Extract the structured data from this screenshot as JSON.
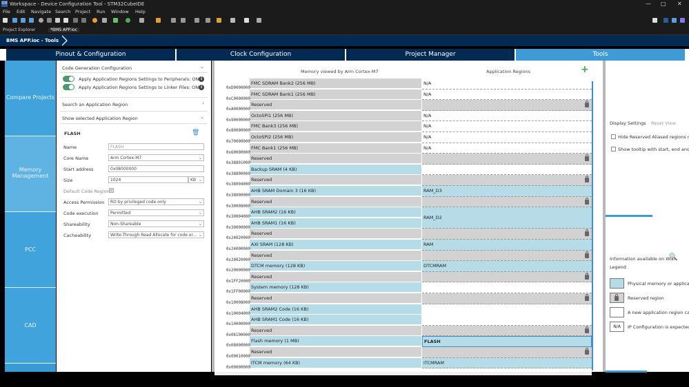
{
  "window": {
    "title": "Workspace - Device Configuration Tool - STM32CubeIDE",
    "controls": [
      "—",
      "□",
      "✕"
    ]
  },
  "menu": [
    "File",
    "Edit",
    "Navigate",
    "Search",
    "Project",
    "Run",
    "Window",
    "Help"
  ],
  "editor_tabs": [
    {
      "label": "Project Explorer",
      "active": false
    },
    {
      "label": "*BMS APP.ioc",
      "active": true
    }
  ],
  "breadcrumb": "BMS APP.ioc - Tools",
  "main_tabs": [
    {
      "label": "Pinout & Configuration",
      "active": false
    },
    {
      "label": "Clock Configuration",
      "active": false
    },
    {
      "label": "Project Manager",
      "active": false
    },
    {
      "label": "Tools",
      "active": true
    }
  ],
  "categories": [
    {
      "label": "Compare Projects",
      "selected": false
    },
    {
      "label": "Memory Management",
      "selected": true
    },
    {
      "label": "PCC",
      "selected": false
    },
    {
      "label": "CAD",
      "selected": false
    }
  ],
  "left": {
    "codegen_title": "Code Generation Configuration",
    "toggle1": "Apply Application Regions Settings to Peripherals: ON",
    "toggle2": "Apply Application Regions Settings to Linker Files: ON",
    "search_region": "Search an Application Region",
    "show_region": "Show selected Application Region",
    "region_title": "FLASH",
    "fields": {
      "name_label": "Name",
      "name_value": "FLASH",
      "core_label": "Core Name",
      "core_value": "Arm Cortex-M7",
      "start_label": "Start address",
      "start_value": "0x08000000",
      "size_label": "Size",
      "size_value": "1024",
      "size_unit": "KB",
      "default_label": "Default Code Region",
      "default_checked": true,
      "access_label": "Access Permission",
      "access_value": "RO by privileged code only",
      "exec_label": "Code execution",
      "exec_value": "Permitted",
      "share_label": "Shareability",
      "share_value": "Non-Shareable",
      "cache_label": "Cacheability",
      "cache_value": "Write-Through Read Allocate for code or..."
    }
  },
  "center": {
    "header_left": "Memory viewed by Arm Cortex-M7",
    "header_right": "Application Regions",
    "addresses": [
      "0xD0000000",
      "0xC0000000",
      "0xA0000000",
      "0x90000000",
      "0x80000000",
      "0x70000000",
      "0x60000000",
      "0x38801000",
      "0x38800000",
      "0x38004000",
      "0x38000000",
      "0x30008000",
      "0x30004000",
      "0x30000000",
      "0x24020000",
      "0x24000000",
      "0x20020000",
      "0x20000000",
      "0x1FF20000",
      "0x1FF00000",
      "0x10008000",
      "0x10004000",
      "0x10000000",
      "0x08100000",
      "0x08000000",
      "0x00010000",
      "0x00000000"
    ],
    "memories": [
      {
        "label": "FMC SDRAM Bank2 (256 MB)",
        "kind": "gray"
      },
      {
        "label": "FMC SDRAM Bank1 (256 MB)",
        "kind": "gray"
      },
      {
        "label": "Reserved",
        "kind": "gray"
      },
      {
        "label": "OctoSPI1 (256 MB)",
        "kind": "gray"
      },
      {
        "label": "FMC Bank3 (256 MB)",
        "kind": "gray"
      },
      {
        "label": "OctoSPI2 (256 MB)",
        "kind": "gray"
      },
      {
        "label": "FMC Bank1 (256 MB)",
        "kind": "gray"
      },
      {
        "label": "Reserved",
        "kind": "gray"
      },
      {
        "label": "Backup SRAM (4 KB)",
        "kind": "blue"
      },
      {
        "label": "Reserved",
        "kind": "gray"
      },
      {
        "label": "AHB SRAM Domain 3 (16 KB)",
        "kind": "blue"
      },
      {
        "label": "Reserved",
        "kind": "gray"
      },
      {
        "label": "AHB SRAM2 (16 KB)",
        "kind": "blue"
      },
      {
        "label": "AHB SRAM1 (16 KB)",
        "kind": "blue"
      },
      {
        "label": "Reserved",
        "kind": "gray"
      },
      {
        "label": "AXI SRAM (128 KB)",
        "kind": "blue"
      },
      {
        "label": "Reserved",
        "kind": "gray"
      },
      {
        "label": "DTCM memory (128 KB)",
        "kind": "blue"
      },
      {
        "label": "Reserved",
        "kind": "gray"
      },
      {
        "label": "System memory (128 KB)",
        "kind": "blue"
      },
      {
        "label": "Reserved",
        "kind": "gray"
      },
      {
        "label": "AHB SRAM2 Code (16 KB)",
        "kind": "blue"
      },
      {
        "label": "AHB SRAM1 Code (16 KB)",
        "kind": "blue"
      },
      {
        "label": "Reserved",
        "kind": "gray"
      },
      {
        "label": "Flash memory (1 MB)",
        "kind": "blue"
      },
      {
        "label": "Reserved",
        "kind": "gray"
      },
      {
        "label": "ITCM memory (64 KB)",
        "kind": "blue"
      }
    ],
    "app_regions": [
      {
        "label": "N/A",
        "kind": "white",
        "rows": 1
      },
      {
        "label": "N/A",
        "kind": "white",
        "rows": 1
      },
      {
        "label": "",
        "kind": "reserved",
        "rows": 1
      },
      {
        "label": "N/A",
        "kind": "white",
        "rows": 1
      },
      {
        "label": "N/A",
        "kind": "white",
        "rows": 1
      },
      {
        "label": "N/A",
        "kind": "white",
        "rows": 1
      },
      {
        "label": "N/A",
        "kind": "white",
        "rows": 1
      },
      {
        "label": "",
        "kind": "reserved",
        "rows": 1
      },
      {
        "label": "",
        "kind": "white",
        "rows": 1
      },
      {
        "label": "",
        "kind": "reserved",
        "rows": 1
      },
      {
        "label": "RAM_D3",
        "kind": "blue",
        "rows": 1
      },
      {
        "label": "",
        "kind": "reserved",
        "rows": 1
      },
      {
        "label": "RAM_D2",
        "kind": "blue",
        "rows": 2
      },
      {
        "label": "",
        "kind": "reserved",
        "rows": 1
      },
      {
        "label": "RAM",
        "kind": "blue",
        "rows": 1
      },
      {
        "label": "",
        "kind": "reserved",
        "rows": 1
      },
      {
        "label": "DTCMRAM",
        "kind": "blue",
        "rows": 1
      },
      {
        "label": "",
        "kind": "reserved",
        "rows": 1
      },
      {
        "label": "",
        "kind": "white",
        "rows": 1
      },
      {
        "label": "",
        "kind": "reserved",
        "rows": 1
      },
      {
        "label": "",
        "kind": "white",
        "rows": 2
      },
      {
        "label": "",
        "kind": "reserved",
        "rows": 1
      },
      {
        "label": "FLASH",
        "kind": "blue",
        "rows": 1,
        "selected": true
      },
      {
        "label": "",
        "kind": "reserved",
        "rows": 1
      },
      {
        "label": "ITCMRAM",
        "kind": "blue",
        "rows": 1
      }
    ]
  },
  "right": {
    "display_settings": "Display Settings",
    "reset_view": "Reset View",
    "opt1": "Hide Reserved Aliased regions n",
    "opt2": "Show tooltip with start, end and",
    "wiki": "Information available on Wiki",
    "legend_title": "Legend",
    "legend": [
      {
        "swatch": "blue",
        "text": "Physical memory or applica"
      },
      {
        "swatch": "lock",
        "text": "Reserved region"
      },
      {
        "swatch": "white",
        "text": "A new application region ca"
      },
      {
        "swatch": "na",
        "swatch_text": "N/A",
        "text": "IP Configuration is expectec"
      }
    ]
  }
}
